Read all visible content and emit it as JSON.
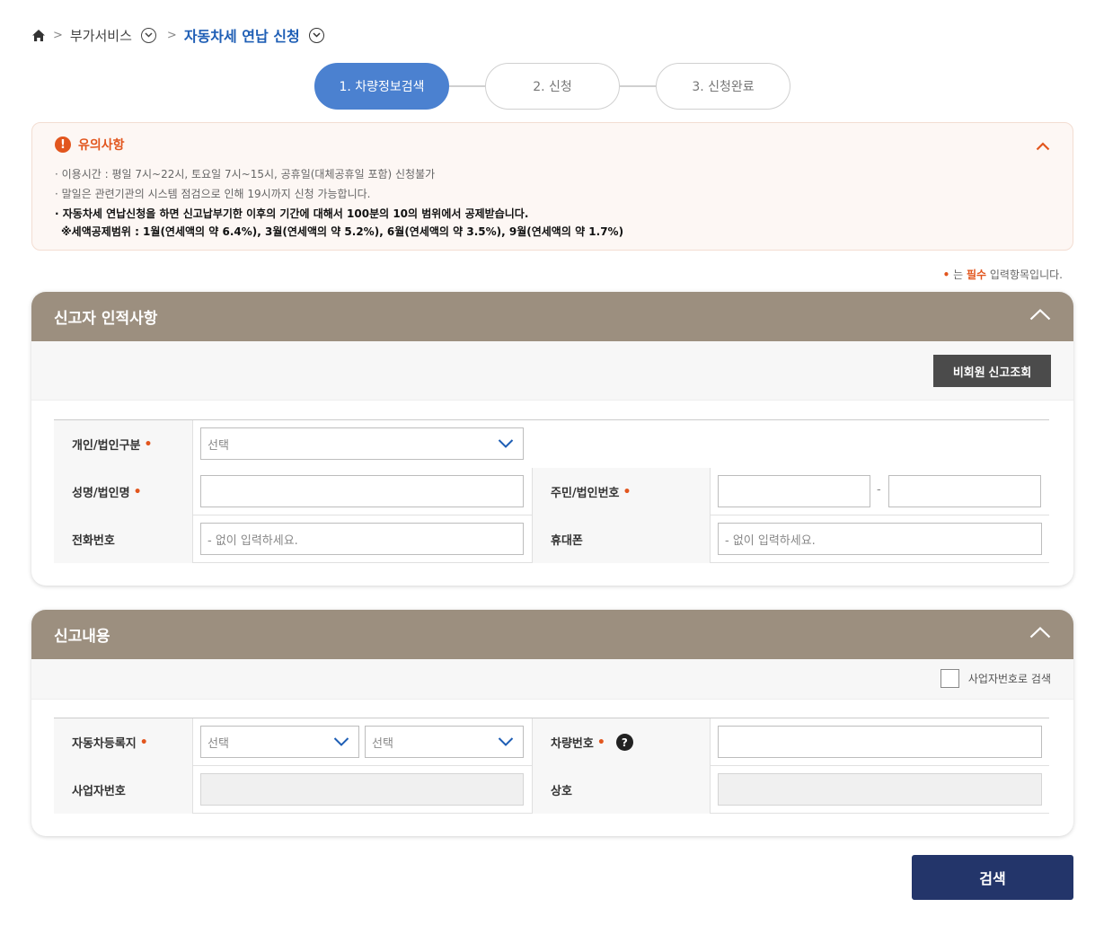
{
  "breadcrumb": {
    "level1": "부가서비스",
    "current": "자동차세 연납 신청"
  },
  "steps": [
    {
      "label": "1. 차량정보검색",
      "active": true
    },
    {
      "label": "2. 신청",
      "active": false
    },
    {
      "label": "3. 신청완료",
      "active": false
    }
  ],
  "notice": {
    "title": "유의사항",
    "items": [
      "· 이용시간 : 평일 7시~22시, 토요일 7시~15시, 공휴일(대체공휴일 포함) 신청불가",
      "· 말일은 관련기관의 시스템 점검으로 인해 19시까지 신청 가능합니다."
    ],
    "bold_line1": "· 자동차세 연납신청을 하면 신고납부기한 이후의 기간에 대해서 100분의 10의 범위에서 공제받습니다.",
    "bold_line2": "※세액공제범위 : 1월(연세액의 약 6.4%), 3월(연세액의 약 5.2%), 6월(연세액의 약 3.5%), 9월(연세액의 약 1.7%)"
  },
  "required_hint": {
    "dot": "•",
    "prefix": " 는 ",
    "word": "필수",
    "suffix": " 입력항목입니다."
  },
  "panel1": {
    "title": "신고자 인적사항",
    "lookup_button": "비회원 신고조회",
    "type_label": "개인/법인구분",
    "type_select": "선택",
    "name_label": "성명/법인명",
    "name_value": "",
    "id_label": "주민/법인번호",
    "id_value1": "",
    "id_value2": "",
    "id_dash": "-",
    "phone_label": "전화번호",
    "phone_placeholder": "- 없이 입력하세요.",
    "mobile_label": "휴대폰",
    "mobile_placeholder": "- 없이 입력하세요."
  },
  "panel2": {
    "title": "신고내용",
    "biz_search_checkbox": "사업자번호로 검색",
    "reg_label": "자동차등록지",
    "reg_select1": "선택",
    "reg_select2": "선택",
    "car_no_label": "차량번호",
    "car_no_value": "",
    "help_icon_text": "?",
    "biz_no_label": "사업자번호",
    "trade_name_label": "상호"
  },
  "search_button": "검색",
  "required_mark": "•",
  "colors": {
    "accent_blue": "#4b81d0",
    "breadcrumb_blue": "#1e5eb5",
    "panel_header": "#9c8f7f",
    "notice_orange": "#e2561e",
    "search_button": "#23356a"
  }
}
